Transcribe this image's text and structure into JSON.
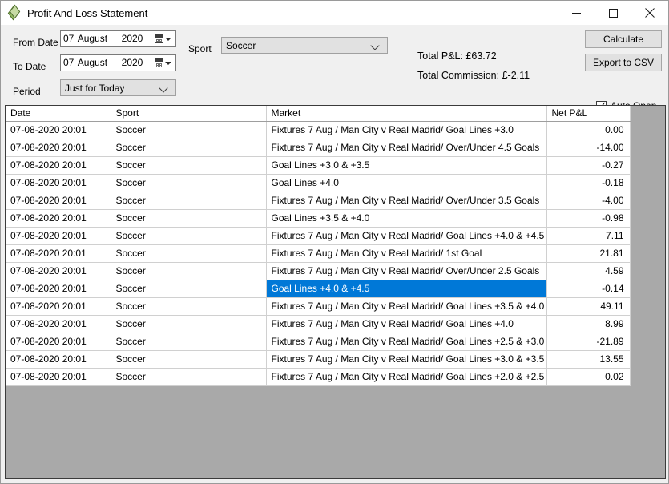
{
  "window": {
    "title": "Profit And Loss Statement",
    "icon": "diamond-icon",
    "minimize_label": "Minimize",
    "maximize_label": "Maximize",
    "close_label": "Close"
  },
  "form": {
    "from_date_label": "From Date",
    "to_date_label": "To Date",
    "period_label": "Period",
    "sport_label": "Sport",
    "from_date": {
      "day": "07",
      "month": "August",
      "year": "2020"
    },
    "to_date": {
      "day": "07",
      "month": "August",
      "year": "2020"
    },
    "period_value": "Just for Today",
    "sport_value": "Soccer",
    "total_pnl": "Total P&L: £63.72",
    "total_commission": "Total Commission: £-2.11"
  },
  "actions": {
    "calculate_label": "Calculate",
    "export_label": "Export to CSV",
    "auto_open_label": "Auto Open",
    "auto_open_checked": true
  },
  "grid": {
    "columns": [
      "Date",
      "Sport",
      "Market",
      "Net P&L"
    ],
    "selected_row_index": 9,
    "rows": [
      {
        "date": "07-08-2020 20:01",
        "sport": "Soccer",
        "market": "Fixtures 7 Aug / Man City v Real Madrid/ Goal Lines +3.0",
        "pnl": "0.00",
        "sign": "pos"
      },
      {
        "date": "07-08-2020 20:01",
        "sport": "Soccer",
        "market": "Fixtures 7 Aug / Man City v Real Madrid/ Over/Under 4.5 Goals",
        "pnl": "-14.00",
        "sign": "neg"
      },
      {
        "date": "07-08-2020 20:01",
        "sport": "Soccer",
        "market": "Goal Lines +3.0 & +3.5",
        "pnl": "-0.27",
        "sign": "neg"
      },
      {
        "date": "07-08-2020 20:01",
        "sport": "Soccer",
        "market": "Goal Lines +4.0",
        "pnl": "-0.18",
        "sign": "neg"
      },
      {
        "date": "07-08-2020 20:01",
        "sport": "Soccer",
        "market": "Fixtures 7 Aug / Man City v Real Madrid/ Over/Under 3.5 Goals",
        "pnl": "-4.00",
        "sign": "neg"
      },
      {
        "date": "07-08-2020 20:01",
        "sport": "Soccer",
        "market": "Goal Lines +3.5 & +4.0",
        "pnl": "-0.98",
        "sign": "neg"
      },
      {
        "date": "07-08-2020 20:01",
        "sport": "Soccer",
        "market": "Fixtures 7 Aug / Man City v Real Madrid/ Goal Lines +4.0 & +4.5",
        "pnl": "7.11",
        "sign": "pos"
      },
      {
        "date": "07-08-2020 20:01",
        "sport": "Soccer",
        "market": "Fixtures 7 Aug / Man City v Real Madrid/ 1st Goal",
        "pnl": "21.81",
        "sign": "pos"
      },
      {
        "date": "07-08-2020 20:01",
        "sport": "Soccer",
        "market": "Fixtures 7 Aug / Man City v Real Madrid/ Over/Under 2.5 Goals",
        "pnl": "4.59",
        "sign": "pos"
      },
      {
        "date": "07-08-2020 20:01",
        "sport": "Soccer",
        "market": "Goal Lines +4.0 & +4.5",
        "pnl": "-0.14",
        "sign": "neg"
      },
      {
        "date": "07-08-2020 20:01",
        "sport": "Soccer",
        "market": "Fixtures 7 Aug / Man City v Real Madrid/ Goal Lines +3.5 & +4.0",
        "pnl": "49.11",
        "sign": "pos"
      },
      {
        "date": "07-08-2020 20:01",
        "sport": "Soccer",
        "market": "Fixtures 7 Aug / Man City v Real Madrid/ Goal Lines +4.0",
        "pnl": "8.99",
        "sign": "pos"
      },
      {
        "date": "07-08-2020 20:01",
        "sport": "Soccer",
        "market": "Fixtures 7 Aug / Man City v Real Madrid/ Goal Lines +2.5 & +3.0",
        "pnl": "-21.89",
        "sign": "neg"
      },
      {
        "date": "07-08-2020 20:01",
        "sport": "Soccer",
        "market": "Fixtures 7 Aug / Man City v Real Madrid/ Goal Lines +3.0 & +3.5",
        "pnl": "13.55",
        "sign": "pos"
      },
      {
        "date": "07-08-2020 20:01",
        "sport": "Soccer",
        "market": "Fixtures 7 Aug / Man City v Real Madrid/ Goal Lines +2.0 & +2.5",
        "pnl": "0.02",
        "sign": "pos"
      }
    ]
  },
  "colors": {
    "selection": "#0078d7",
    "positive": "#108a35",
    "negative": "#e8443a",
    "grid_background": "#a9a9a9",
    "form_background": "#f0f0f0"
  }
}
